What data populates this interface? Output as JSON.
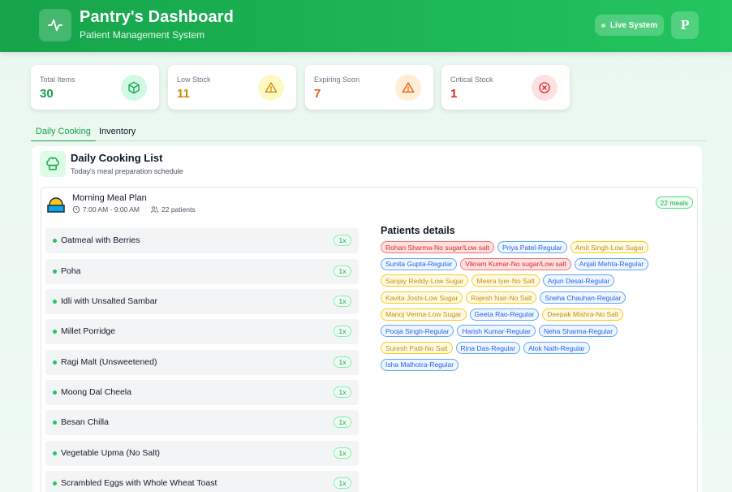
{
  "header": {
    "title": "Pantry's Dashboard",
    "subtitle": "Patient Management System",
    "live_label": "Live System",
    "avatar_initial": "P"
  },
  "stats": [
    {
      "label": "Total Items",
      "value": "30",
      "color": "#16a34a",
      "bg": "#dcfce7",
      "icon": "cube-icon"
    },
    {
      "label": "Low Stock",
      "value": "11",
      "color": "#ca8a04",
      "bg": "#fef9c3",
      "icon": "warning-icon"
    },
    {
      "label": "Expiring Soon",
      "value": "7",
      "color": "#ea580c",
      "bg": "#ffedd5",
      "icon": "warning-icon"
    },
    {
      "label": "Critical Stock",
      "value": "1",
      "color": "#dc2626",
      "bg": "#fee2e2",
      "icon": "x-circle-icon"
    }
  ],
  "tabs": [
    {
      "label": "Daily Cooking",
      "active": true
    },
    {
      "label": "Inventory",
      "active": false
    }
  ],
  "cooking": {
    "title": "Daily Cooking List",
    "subtitle": "Today's meal preparation schedule",
    "meal": {
      "title": "Morning Meal Plan",
      "time": "7:00 AM - 9:00 AM",
      "patients": "22 patients",
      "badge": "22 meals"
    },
    "dishes": [
      {
        "name": "Oatmeal with Berries",
        "qty": "1x"
      },
      {
        "name": "Poha",
        "qty": "1x"
      },
      {
        "name": "Idli with Unsalted Sambar",
        "qty": "1x"
      },
      {
        "name": "Millet Porridge",
        "qty": "1x"
      },
      {
        "name": "Ragi Malt (Unsweetened)",
        "qty": "1x"
      },
      {
        "name": "Moong Dal Cheela",
        "qty": "1x"
      },
      {
        "name": "Besan Chilla",
        "qty": "1x"
      },
      {
        "name": "Vegetable Upma (No Salt)",
        "qty": "1x"
      },
      {
        "name": "Scrambled Eggs with Whole Wheat Toast",
        "qty": "1x"
      }
    ],
    "patients_title": "Patients details",
    "patient_rows": [
      [
        {
          "text": "Rohan Sharma-No sugar/Low salt",
          "type": "red"
        },
        {
          "text": "Priya Patel-Regular",
          "type": "blue"
        },
        {
          "text": "Amit Singh-Low Sugar",
          "type": "yellow"
        }
      ],
      [
        {
          "text": "Sunita Gupta-Regular",
          "type": "blue"
        },
        {
          "text": "Vikram Kumar-No sugar/Low salt",
          "type": "red"
        },
        {
          "text": "Anjali Mehta-Regular",
          "type": "blue"
        }
      ],
      [
        {
          "text": "Sanjay Reddy-Low Sugar",
          "type": "yellow"
        },
        {
          "text": "Meera Iyer-No Salt",
          "type": "yellow"
        },
        {
          "text": "Arjun Desai-Regular",
          "type": "blue"
        }
      ],
      [
        {
          "text": "Kavita Joshi-Low Sugar",
          "type": "yellow"
        },
        {
          "text": "Rajesh Nair-No Salt",
          "type": "yellow"
        },
        {
          "text": "Sneha Chauhan-Regular",
          "type": "blue"
        }
      ],
      [
        {
          "text": "Manoj Verma-Low Sugar",
          "type": "yellow"
        },
        {
          "text": "Geeta Rao-Regular",
          "type": "blue"
        },
        {
          "text": "Deepak Mishra-No Salt",
          "type": "yellow"
        }
      ],
      [
        {
          "text": "Pooja Singh-Regular",
          "type": "blue"
        },
        {
          "text": "Harish Kumar-Regular",
          "type": "blue"
        },
        {
          "text": "Neha Sharma-Regular",
          "type": "blue"
        }
      ],
      [
        {
          "text": "Suresh Patil-No Salt",
          "type": "yellow"
        },
        {
          "text": "Rina Das-Regular",
          "type": "blue"
        },
        {
          "text": "Alok Nath-Regular",
          "type": "blue"
        }
      ],
      [
        {
          "text": "Isha Malhotra-Regular",
          "type": "blue"
        }
      ]
    ]
  }
}
